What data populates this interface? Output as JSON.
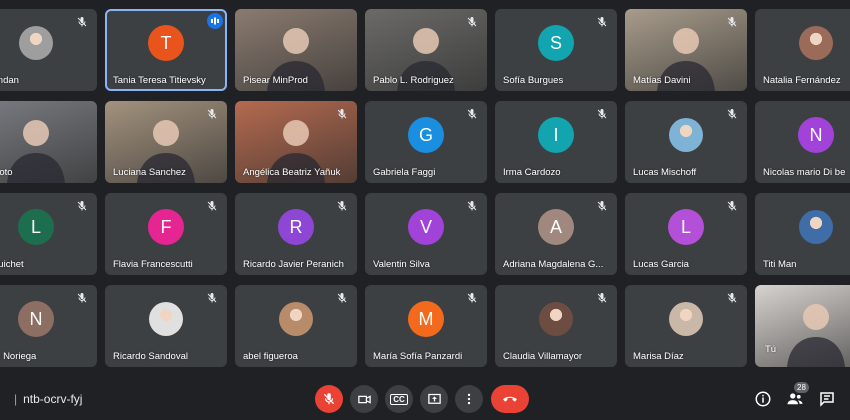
{
  "participants": [
    {
      "name": "Brandan",
      "type": "photo",
      "initial": "",
      "color": "#9e9e9e",
      "muted": true
    },
    {
      "name": "Tania Teresa Titievsky",
      "type": "initial",
      "initial": "T",
      "color": "#e8541c",
      "muted": false,
      "speaking": true
    },
    {
      "name": "Pisear MinProd",
      "type": "video",
      "initial": "",
      "color": "#8a7b70",
      "muted": false
    },
    {
      "name": "Pablo L. Rodriguez",
      "type": "video",
      "initial": "",
      "color": "#6b6a69",
      "muted": true
    },
    {
      "name": "Sofía Burgues",
      "type": "initial",
      "initial": "S",
      "color": "#12a4af",
      "muted": true
    },
    {
      "name": "Matías Davini",
      "type": "video",
      "initial": "",
      "color": "#a89c8b",
      "muted": true
    },
    {
      "name": "Natalia Fernández",
      "type": "photo",
      "initial": "",
      "color": "#9b6b5a",
      "muted": true
    },
    {
      "name": "ar Loto",
      "type": "video",
      "initial": "",
      "color": "#7b7c82",
      "muted": false
    },
    {
      "name": "Luciana Sanchez",
      "type": "video",
      "initial": "",
      "color": "#a3927e",
      "muted": true
    },
    {
      "name": "Angélica Beatriz Yañuk",
      "type": "video",
      "initial": "",
      "color": "#b56a4f",
      "muted": true
    },
    {
      "name": "Gabriela Faggi",
      "type": "initial",
      "initial": "G",
      "color": "#1a8fe0",
      "muted": true
    },
    {
      "name": "Irma Cardozo",
      "type": "initial",
      "initial": "I",
      "color": "#12a4af",
      "muted": true
    },
    {
      "name": "Lucas Mischoff",
      "type": "photo",
      "initial": "",
      "color": "#7fb3d5",
      "muted": true
    },
    {
      "name": "Nicolas mario Di be",
      "type": "initial",
      "initial": "N",
      "color": "#a142d9",
      "muted": true
    },
    {
      "name": "o Guichet",
      "type": "initial",
      "initial": "L",
      "color": "#1d6e4e",
      "muted": true
    },
    {
      "name": "Flavia Francescutti",
      "type": "initial",
      "initial": "F",
      "color": "#e52592",
      "muted": true
    },
    {
      "name": "Ricardo Javier Peranich",
      "type": "initial",
      "initial": "R",
      "color": "#8e47d4",
      "muted": true
    },
    {
      "name": "Valentin Silva",
      "type": "initial",
      "initial": "V",
      "color": "#a142d9",
      "muted": true
    },
    {
      "name": "Adriana Magdalena G...",
      "type": "initial",
      "initial": "A",
      "color": "#a1887f",
      "muted": true
    },
    {
      "name": "Lucas Garcia",
      "type": "initial",
      "initial": "L",
      "color": "#b44fd8",
      "muted": true
    },
    {
      "name": "Titi Man",
      "type": "photo",
      "initial": "",
      "color": "#3e6da8",
      "muted": true
    },
    {
      "name": "olás Noriega",
      "type": "initial",
      "initial": "N",
      "color": "#8d6e63",
      "muted": true
    },
    {
      "name": "Ricardo Sandoval",
      "type": "photo",
      "initial": "",
      "color": "#e0e0e0",
      "muted": true
    },
    {
      "name": "abel figueroa",
      "type": "photo",
      "initial": "",
      "color": "#b88b6a",
      "muted": true
    },
    {
      "name": "María Sofía Panzardi",
      "type": "initial",
      "initial": "M",
      "color": "#f36a1d",
      "muted": true
    },
    {
      "name": "Claudia Villamayor",
      "type": "photo",
      "initial": "",
      "color": "#6d4c41",
      "muted": true
    },
    {
      "name": "Marisa Díaz",
      "type": "photo",
      "initial": "",
      "color": "#c9b7a8",
      "muted": true
    },
    {
      "name": "Tú",
      "type": "video",
      "initial": "",
      "color": "#d7d3cf",
      "muted": false
    }
  ],
  "meeting": {
    "code": "ntb-ocrv-fyj",
    "separator": "|"
  },
  "controls": {
    "mic_icon": "mic-off-icon",
    "camera_icon": "camera-icon",
    "captions_label": "CC",
    "present_icon": "present-icon",
    "more_icon": "more-vert-icon",
    "hangup_icon": "phone-hangup-icon"
  },
  "right_controls": {
    "people_count": "28"
  },
  "colors": {
    "background": "#202124",
    "tile": "#3c4043",
    "danger": "#ea4335",
    "active_outline": "#8ab4f8"
  }
}
